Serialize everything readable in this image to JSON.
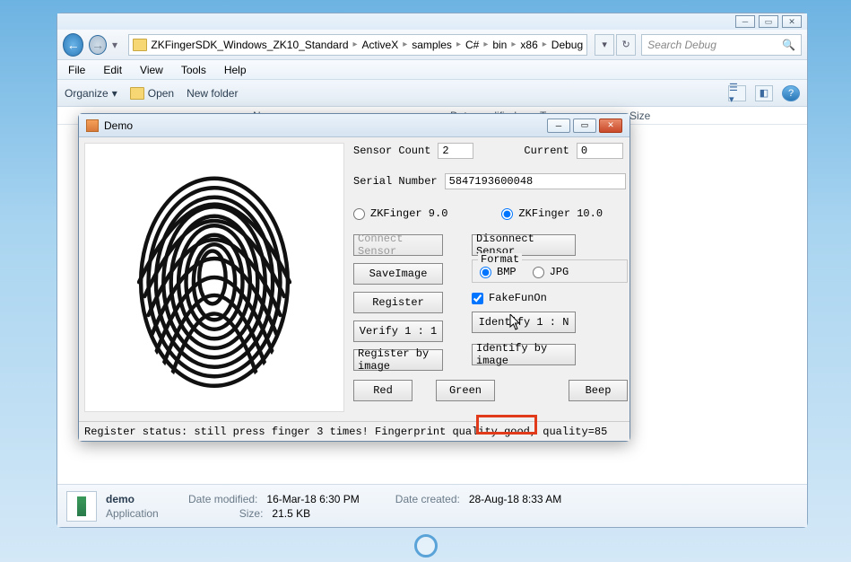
{
  "explorer": {
    "breadcrumb": [
      "ZKFingerSDK_Windows_ZK10_Standard",
      "ActiveX",
      "samples",
      "C#",
      "bin",
      "x86",
      "Debug"
    ],
    "search_placeholder": "Search Debug",
    "menus": [
      "File",
      "Edit",
      "View",
      "Tools",
      "Help"
    ],
    "toolbar": {
      "organize": "Organize",
      "open": "Open",
      "newfolder": "New folder"
    },
    "columns": {
      "name": "Name",
      "date": "Date modified",
      "type": "Type",
      "size": "Size"
    },
    "details": {
      "name": "demo",
      "type": "Application",
      "date_modified_label": "Date modified:",
      "date_modified": "16-Mar-18 6:30 PM",
      "date_created_label": "Date created:",
      "date_created": "28-Aug-18 8:33 AM",
      "size_label": "Size:",
      "size": "21.5 KB"
    }
  },
  "demo": {
    "title": "Demo",
    "sensor_count_label": "Sensor Count",
    "sensor_count": "2",
    "current_label": "Current",
    "current": "0",
    "serial_label": "Serial Number",
    "serial": "5847193600048",
    "radio9": "ZKFinger 9.0",
    "radio10": "ZKFinger 10.0",
    "connect": "Connect Sensor",
    "disconnect": "Disonnect Sensor",
    "saveimage": "SaveImage",
    "format_label": "Format",
    "bmp": "BMP",
    "jpg": "JPG",
    "register": "Register",
    "fakefun": "FakeFunOn",
    "verify": "Verify 1 : 1",
    "identify": "Identify 1 : N",
    "register_img": "Register by image",
    "identify_img": "Identify by image",
    "red": "Red",
    "green": "Green",
    "beep": "Beep",
    "status": "Register status: still press finger 3 times! Fingerprint quality good, quality=85"
  }
}
